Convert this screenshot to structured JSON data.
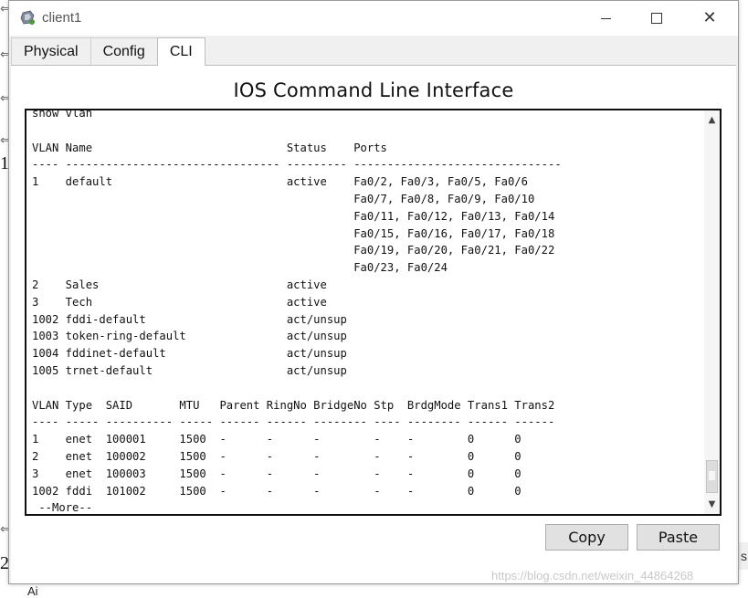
{
  "window": {
    "title": "client1",
    "icon": "packet-tracer-pc-icon"
  },
  "tabs": [
    {
      "label": "Physical",
      "active": false
    },
    {
      "label": "Config",
      "active": false
    },
    {
      "label": "CLI",
      "active": true
    }
  ],
  "panel": {
    "title": "IOS Command Line Interface"
  },
  "terminal": {
    "lines": [
      "show vlan",
      "",
      "VLAN Name                             Status    Ports",
      "---- -------------------------------- --------- -------------------------------",
      "1    default                          active    Fa0/2, Fa0/3, Fa0/5, Fa0/6",
      "                                                Fa0/7, Fa0/8, Fa0/9, Fa0/10",
      "                                                Fa0/11, Fa0/12, Fa0/13, Fa0/14",
      "                                                Fa0/15, Fa0/16, Fa0/17, Fa0/18",
      "                                                Fa0/19, Fa0/20, Fa0/21, Fa0/22",
      "                                                Fa0/23, Fa0/24",
      "2    Sales                            active",
      "3    Tech                             active",
      "1002 fddi-default                     act/unsup",
      "1003 token-ring-default               act/unsup",
      "1004 fddinet-default                  act/unsup",
      "1005 trnet-default                    act/unsup",
      "",
      "VLAN Type  SAID       MTU   Parent RingNo BridgeNo Stp  BrdgMode Trans1 Trans2",
      "---- ----- ---------- ----- ------ ------ -------- ---- -------- ------ ------",
      "1    enet  100001     1500  -      -      -        -    -        0      0",
      "2    enet  100002     1500  -      -      -        -    -        0      0",
      "3    enet  100003     1500  -      -      -        -    -        0      0",
      "1002 fddi  101002     1500  -      -      -        -    -        0      0",
      " --More--"
    ]
  },
  "buttons": {
    "copy": "Copy",
    "paste": "Paste"
  },
  "background": {
    "numbers": [
      "1",
      "2"
    ],
    "watermark": "https://blog.csdn.net/weixin_44864268",
    "right_strip": "s",
    "bottom_fragment": "Ai"
  }
}
